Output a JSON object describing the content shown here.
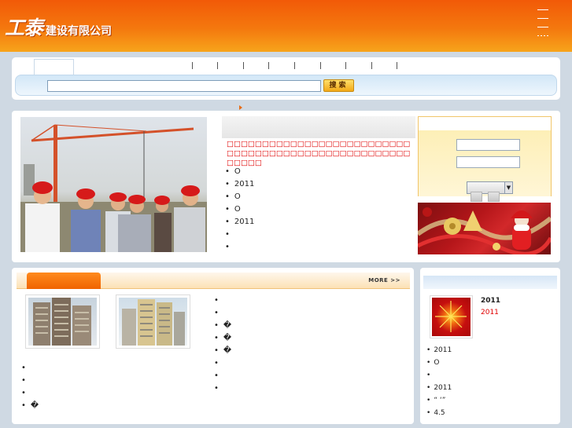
{
  "header": {
    "logo_main": "工泰",
    "logo_sub": "建设有限公司"
  },
  "search": {
    "button_label": "搜索",
    "value": ""
  },
  "news": {
    "headline": "□□□□□□□□□□□□□□□□□□□□□□□□□□□□□□□□□□□□□□□□□□□□□□□□□□□□□□□□□",
    "items": [
      "O",
      "2011",
      "O",
      "O",
      "2011",
      "",
      ""
    ]
  },
  "section_more": "MORE >>",
  "projects": {
    "list_left": [
      "",
      "",
      "",
      "�"
    ],
    "list_right": [
      "",
      "",
      "�",
      "�",
      "�",
      "",
      "",
      ""
    ]
  },
  "sidebar": {
    "feature_title": "2011",
    "feature_subtitle": "2011",
    "items": [
      "2011",
      "O",
      "",
      "2011",
      "“ ‘”",
      "4.5"
    ]
  },
  "colors": {
    "header_orange": "#f4780e",
    "accent_red": "#e00000",
    "nav_blue": "#d2e7f7"
  }
}
